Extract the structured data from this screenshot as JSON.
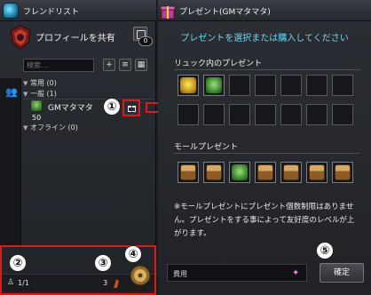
{
  "friend_panel": {
    "title": "フレンドリスト",
    "profile_share_label": "プロフィールを共有",
    "share_badge": "0",
    "search_placeholder": "検索…",
    "groups": {
      "favorites": "常用 (0)",
      "general": "一般 (1)",
      "offline": "オフライン (0)"
    },
    "friend": {
      "name": "GMマタマタ",
      "level": "50"
    },
    "bottom": {
      "online": "1/1",
      "gift_count": "3"
    }
  },
  "present_panel": {
    "title": "プレゼント(GMマタマタ)",
    "instruction": "プレゼントを選択または購入してください",
    "inventory_label": "リュック内のプレゼント",
    "mall_label": "モールプレゼント",
    "notice": "※モールプレゼントにプレゼント個数制限はありません。プレゼントをする事によって友好度のレベルが上がります。",
    "cost_label": "費用",
    "confirm_label": "確定"
  },
  "callouts": {
    "c1": "①",
    "c2": "②",
    "c3": "③",
    "c4": "④",
    "c5": "⑤"
  },
  "colors": {
    "highlight": "#e01818",
    "instruction": "#66d8f2"
  },
  "inventory_slots": [
    "yellow-item",
    "frog-item",
    "",
    "",
    "",
    "",
    "",
    "",
    "",
    "",
    "",
    "",
    "",
    ""
  ],
  "mall_slots": [
    "chest-item",
    "chest-item",
    "frog-item",
    "chest-item",
    "chest-item",
    "chest-item",
    "chest-item"
  ]
}
